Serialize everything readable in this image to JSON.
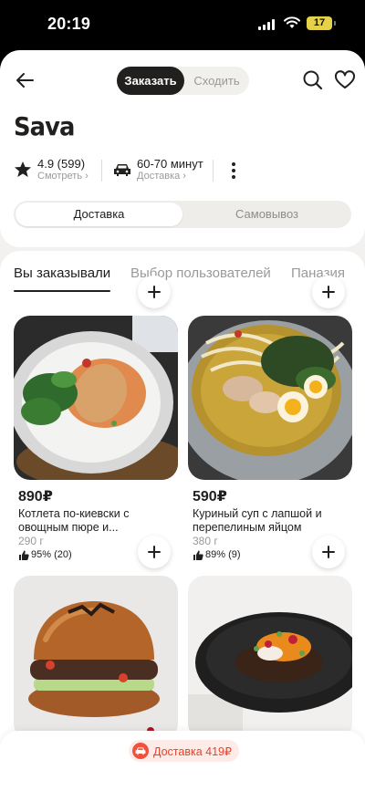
{
  "status_bar": {
    "time": "20:19",
    "battery": "17"
  },
  "header": {
    "mode_active": "Заказать",
    "mode_inactive": "Сходить"
  },
  "restaurant": {
    "name": "Sava",
    "rating": "4.9 (599)",
    "rating_sub": "Смотреть",
    "delivery_time": "60-70 минут",
    "delivery_sub": "Доставка"
  },
  "delivery_toggle": {
    "active": "Доставка",
    "inactive": "Самовывоз"
  },
  "categories": [
    "Вы заказывали",
    "Выбор пользователей",
    "Паназия"
  ],
  "products": [
    {
      "price": "890₽",
      "name": "Котлета по-киевски с овощным пюре и...",
      "weight": "290 г",
      "rating": "95% (20)"
    },
    {
      "price": "590₽",
      "name": "Куриный суп с лапшой и перепелиным яйцом",
      "weight": "380 г",
      "rating": "89% (9)"
    },
    {
      "price": "",
      "name": "",
      "weight": "",
      "rating": ""
    },
    {
      "price": "",
      "name": "",
      "weight": "",
      "rating": ""
    }
  ],
  "bottom": {
    "delivery_label": "Доставка 419₽"
  },
  "colors": {
    "accent_dark": "#21201f",
    "delivery_red": "#f0503c",
    "muted": "#9a9a98"
  },
  "icons": [
    "back-arrow-icon",
    "search-icon",
    "heart-icon",
    "star-icon",
    "car-icon",
    "more-icon",
    "plus-icon",
    "thumbs-up-icon"
  ]
}
